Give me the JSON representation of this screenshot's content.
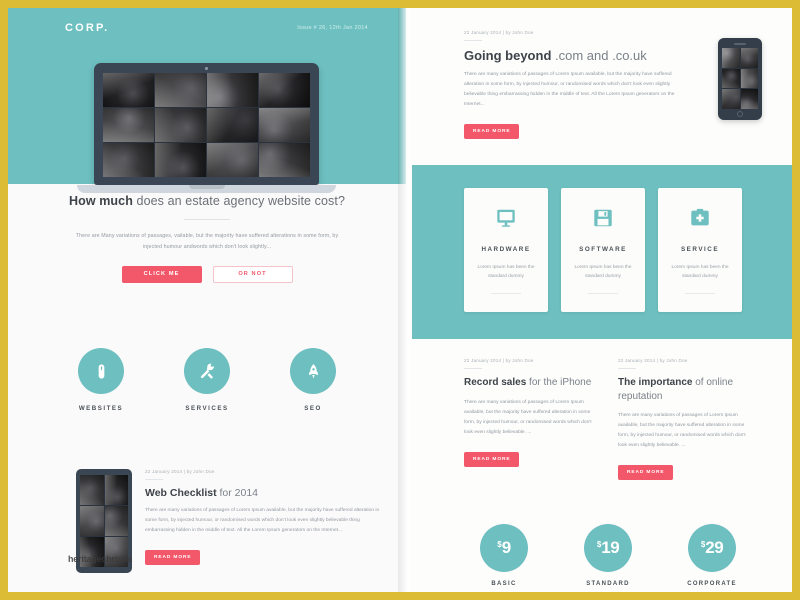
{
  "frame": {
    "border_color": "#dcbc35",
    "page_bg": "#fbfafa",
    "accent_teal": "#6dbfc0",
    "accent_red": "#f2576a"
  },
  "left_page": {
    "brand": "CORP.",
    "issue": "Issue # 26, 12th Jan 2014",
    "hero_device": "laptop-mockup",
    "headline": {
      "strong": "How much",
      "rest": " does an estate agency website cost?"
    },
    "body": "There are Many variations of passages, vailable, but the majority have suffered alterations in some form, by injected humour andwords which don't look slightly...",
    "buttons": {
      "primary": "CLICK ME",
      "secondary": "OR NOT"
    },
    "services": [
      {
        "label": "WEBSITES",
        "icon": "mouse-icon"
      },
      {
        "label": "SERVICES",
        "icon": "tools-icon"
      },
      {
        "label": "SEO",
        "icon": "rocket-icon"
      }
    ],
    "article": {
      "meta": "22 January 2014  |  by John Doe",
      "title_strong": "Web Checklist",
      "title_rest": " for 2014",
      "body": "There are many variations of passages of Lorem Ipsum available, but the majority have suffered alteration in some form, by injected humour, or randomised words which don't look even slightly believable thing embarrassing hidden in the middle of text. All the Lorem Ipsum generators on the Internet...",
      "button": "READ MORE",
      "device": "tablet-mockup"
    },
    "watermark": "heritagechristia"
  },
  "right_page": {
    "feature": {
      "meta": "22 January 2014  |  by John Doe",
      "title_strong": "Going beyond",
      "title_rest": " .com and .co.uk",
      "body": "There are many variations of passages of Lorem Ipsum available, but the majority have suffered alteration in some form, by injected humour, or randomised words which don't look even slightly believable thing embarrassing hidden in the middle of text. All the Lorem Ipsum generators on the Internet...",
      "button": "READ MORE",
      "device": "phone-mockup"
    },
    "cards": [
      {
        "title": "HARDWARE",
        "text": "Lorem Ipsum has been the standard dummy",
        "icon": "monitor-icon"
      },
      {
        "title": "SOFTWARE",
        "text": "Lorem Ipsum has been the standard dummy",
        "icon": "floppy-disk-icon"
      },
      {
        "title": "SERVICE",
        "text": "Lorem Ipsum has been the standard dummy",
        "icon": "medical-kit-icon"
      }
    ],
    "posts": [
      {
        "meta": "22 January 2014  |  by John Doe",
        "title_strong": "Record sales",
        "title_rest": " for the iPhone",
        "body": "There are many variations of passages of Lorem Ipsum available, but the majority have suffered alteration in some form, by injected humour, or randomised words which don't look even slightly believable. ...",
        "button": "READ MORE"
      },
      {
        "meta": "22 January 2014  |  by John Doe",
        "title_strong": "The importance",
        "title_rest": " of online reputation",
        "body": "There are many variations of passages of Lorem Ipsum available, but the majority have suffered alteration in some form, by injected humour, or randomised words which don't look even slightly believable. ...",
        "button": "READ MORE"
      }
    ],
    "pricing": [
      {
        "currency": "$",
        "amount": "9",
        "label": "BASIC"
      },
      {
        "currency": "$",
        "amount": "19",
        "label": "STANDARD"
      },
      {
        "currency": "$",
        "amount": "29",
        "label": "CORPORATE"
      }
    ]
  }
}
